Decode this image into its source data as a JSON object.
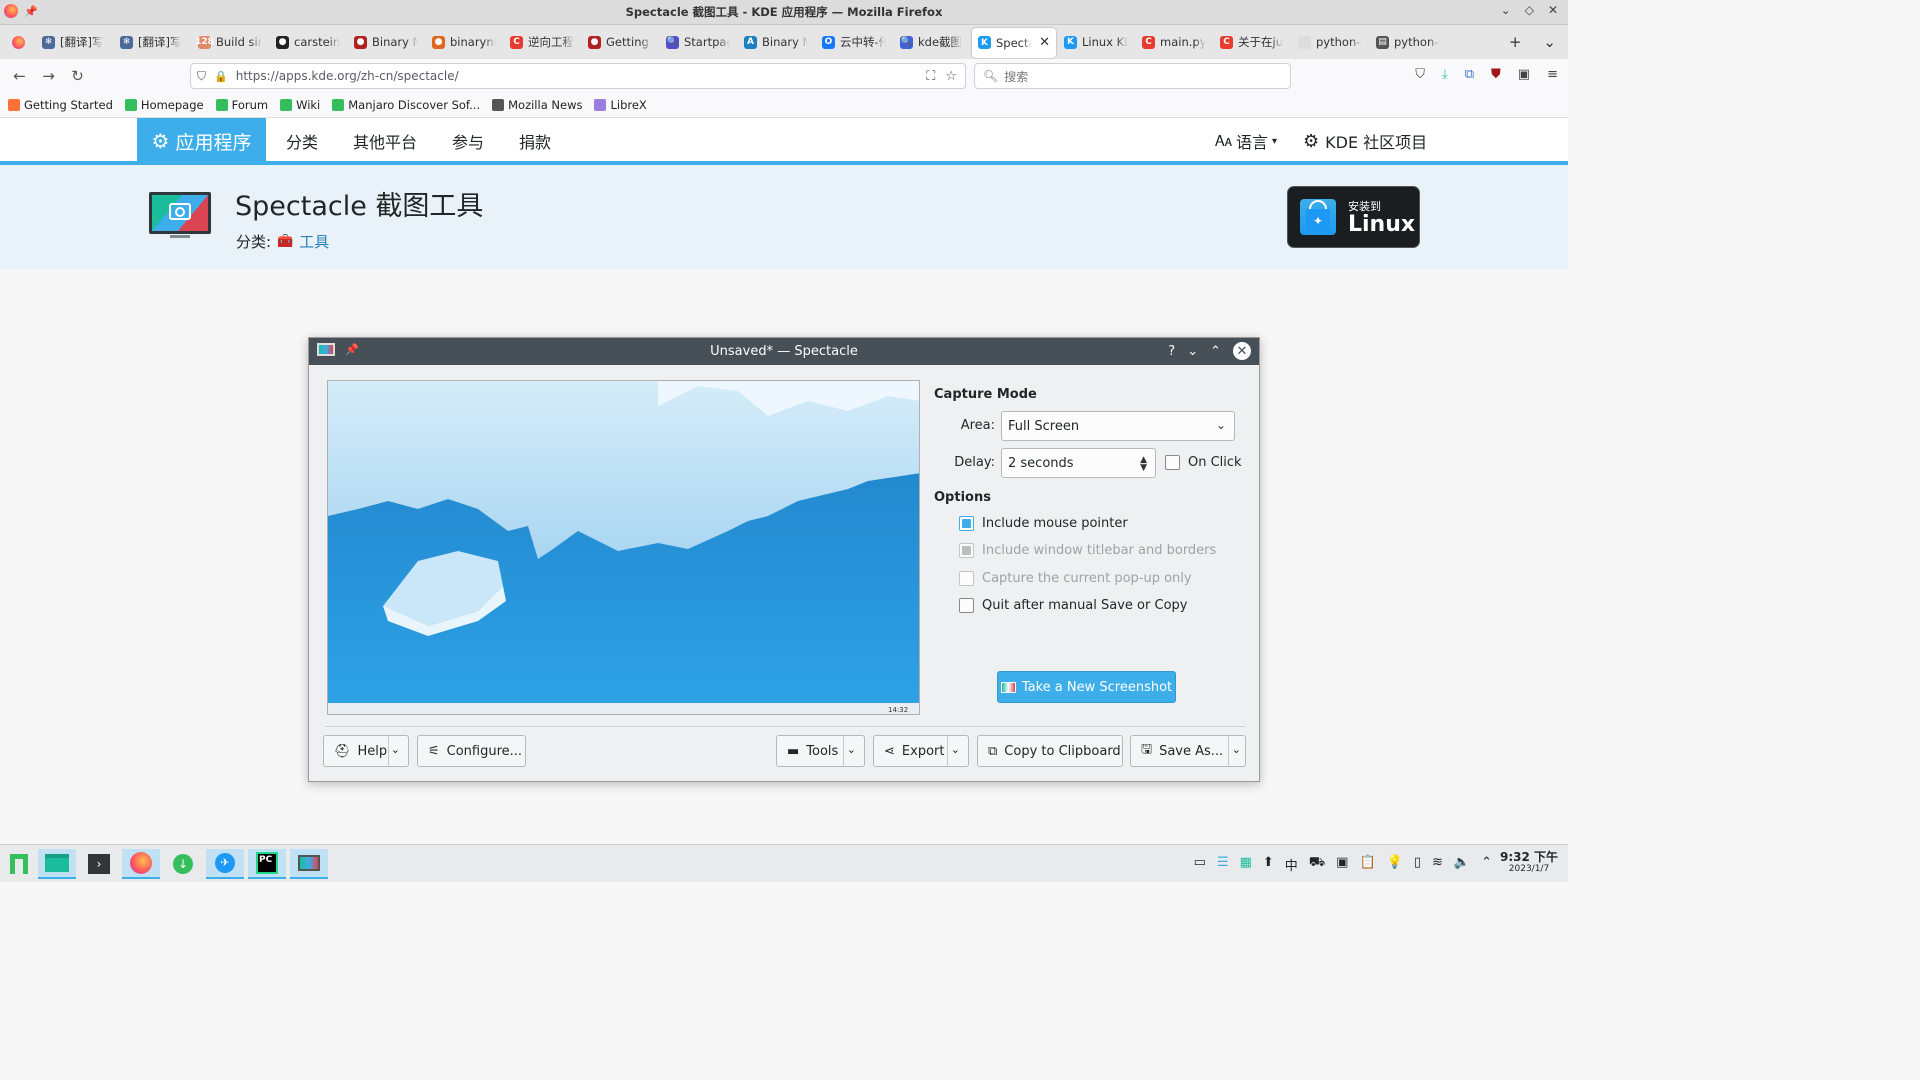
{
  "window": {
    "title": "Spectacle 截图工具 - KDE 应用程序 — Mozilla Firefox"
  },
  "tabs": [
    {
      "label": "[翻译]写",
      "color": "#4a6a9a",
      "glyph": "❄"
    },
    {
      "label": "[翻译]写",
      "color": "#4a6a9a",
      "glyph": "❄"
    },
    {
      "label": "Build sim",
      "color": "#e08a6a",
      "glyph": "128"
    },
    {
      "label": "carstein",
      "color": "#222222",
      "glyph": "●"
    },
    {
      "label": "Binary N",
      "color": "#b0221f",
      "glyph": "●"
    },
    {
      "label": "binaryni",
      "color": "#e0671f",
      "glyph": "●"
    },
    {
      "label": "逆向工程",
      "color": "#e63b2e",
      "glyph": "C"
    },
    {
      "label": "Getting S",
      "color": "#b0221f",
      "glyph": "●"
    },
    {
      "label": "Startpag",
      "color": "#5050c8",
      "glyph": "🔍"
    },
    {
      "label": "Binary N",
      "color": "#1e7fc0",
      "glyph": "A"
    },
    {
      "label": "云中转-佧",
      "color": "#1677ff",
      "glyph": "O"
    },
    {
      "label": "kde截图",
      "color": "#4161d6",
      "glyph": "🔍"
    },
    {
      "label": "Specta",
      "color": "#1d99f3",
      "glyph": "K",
      "active": true
    },
    {
      "label": "Linux KD",
      "color": "#1d99f3",
      "glyph": "K"
    },
    {
      "label": "main.py",
      "color": "#e63b2e",
      "glyph": "C"
    },
    {
      "label": "关于在ju",
      "color": "#e63b2e",
      "glyph": "C"
    },
    {
      "label": "python-p",
      "color": "#dddddd",
      "glyph": ""
    },
    {
      "label": "python-p",
      "color": "#555555",
      "glyph": "▤"
    }
  ],
  "nav": {
    "url": "https://apps.kde.org/zh-cn/spectacle/",
    "search_placeholder": "搜索"
  },
  "bookmarks": [
    {
      "label": "Getting Started",
      "color": "#ff7139"
    },
    {
      "label": "Homepage",
      "color": "#35bf5c"
    },
    {
      "label": "Forum",
      "color": "#35bf5c"
    },
    {
      "label": "Wiki",
      "color": "#35bf5c"
    },
    {
      "label": "Manjaro Discover Sof...",
      "color": "#35bf5c"
    },
    {
      "label": "Mozilla News",
      "color": "#555555"
    },
    {
      "label": "LibreX",
      "color": "#9a7de0"
    }
  ],
  "site": {
    "brand": "应用程序",
    "menu": [
      "分类",
      "其他平台",
      "参与",
      "捐款"
    ],
    "language": "语言",
    "community": "KDE 社区项目",
    "title": "Spectacle 截图工具",
    "category_label": "分类:",
    "category_link": "工具",
    "install_small": "安装到",
    "install_big": "Linux"
  },
  "spectacle": {
    "title": "Unsaved* — Spectacle",
    "capture_mode": "Capture Mode",
    "area_label": "Area:",
    "area_value": "Full Screen",
    "delay_label": "Delay:",
    "delay_value": "2 seconds",
    "on_click": "On Click",
    "options": "Options",
    "opt_pointer": "Include mouse pointer",
    "opt_titlebar": "Include window titlebar and borders",
    "opt_popup": "Capture the current pop-up only",
    "opt_quit": "Quit after manual Save or Copy",
    "take": "Take a New Screenshot",
    "help": "Help",
    "configure": "Configure...",
    "tools": "Tools",
    "export": "Export",
    "copy": "Copy to Clipboard",
    "save": "Save As...",
    "preview_clock": "14:32"
  },
  "taskbar": {
    "time": "9:32 下午",
    "date": "2023/1/7"
  }
}
